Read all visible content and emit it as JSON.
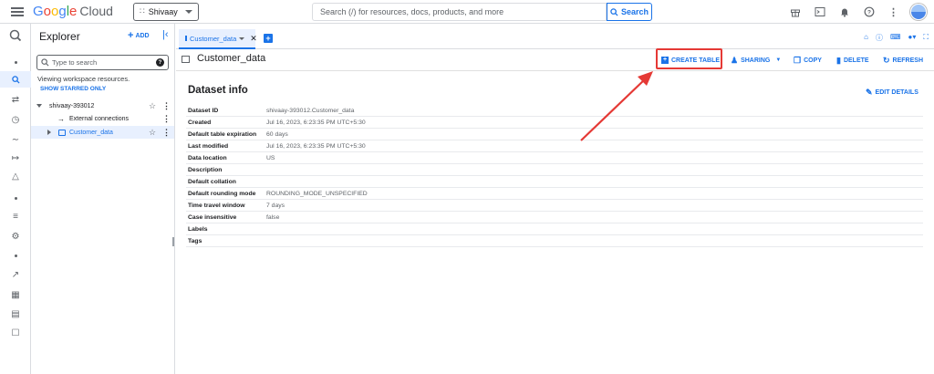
{
  "header": {
    "logo": {
      "google": "Google",
      "cloud": "Cloud"
    },
    "project": "Shivaay",
    "search_placeholder": "Search (/) for resources, docs, products, and more",
    "search_button": "Search",
    "icons": [
      "gift-icon",
      "terminal-icon",
      "bell-icon",
      "help-icon",
      "more-vert-icon",
      "avatar"
    ]
  },
  "rail": {
    "icons": [
      "bigquery-logo-icon",
      "search-icon",
      "transfers-icon",
      "history-icon",
      "scheduled-icon",
      "workflow-icon",
      "analytics-hub-icon",
      "list-icon",
      "wrench-icon",
      "chart-icon",
      "grid-icon",
      "table-icon",
      "lock-icon"
    ]
  },
  "explorer": {
    "title": "Explorer",
    "add_label": "ADD",
    "search_placeholder": "Type to search",
    "viewing": "Viewing workspace resources.",
    "show_starred": "SHOW STARRED ONLY",
    "tree": {
      "project": "shivaay-393012",
      "connections": "External connections",
      "dataset": "Customer_data"
    }
  },
  "tabs": [
    {
      "label": "Customer_data"
    }
  ],
  "page": {
    "title": "Customer_data",
    "actions": {
      "create_table": "CREATE TABLE",
      "sharing": "SHARING",
      "copy": "COPY",
      "delete": "DELETE",
      "refresh": "REFRESH"
    },
    "section_title": "Dataset info",
    "edit_details": "EDIT DETAILS",
    "info": [
      {
        "key": "Dataset ID",
        "value": "shivaay-393012.Customer_data"
      },
      {
        "key": "Created",
        "value": "Jul 16, 2023, 6:23:35 PM UTC+5:30"
      },
      {
        "key": "Default table expiration",
        "value": "60 days"
      },
      {
        "key": "Last modified",
        "value": "Jul 16, 2023, 6:23:35 PM UTC+5:30"
      },
      {
        "key": "Data location",
        "value": "US"
      },
      {
        "key": "Description",
        "value": ""
      },
      {
        "key": "Default collation",
        "value": ""
      },
      {
        "key": "Default rounding mode",
        "value": "ROUNDING_MODE_UNSPECIFIED"
      },
      {
        "key": "Time travel window",
        "value": "7 days"
      },
      {
        "key": "Case insensitive",
        "value": "false"
      },
      {
        "key": "Labels",
        "value": ""
      },
      {
        "key": "Tags",
        "value": ""
      }
    ]
  },
  "colors": {
    "accent": "#1a73e8",
    "highlight": "#e53935"
  }
}
